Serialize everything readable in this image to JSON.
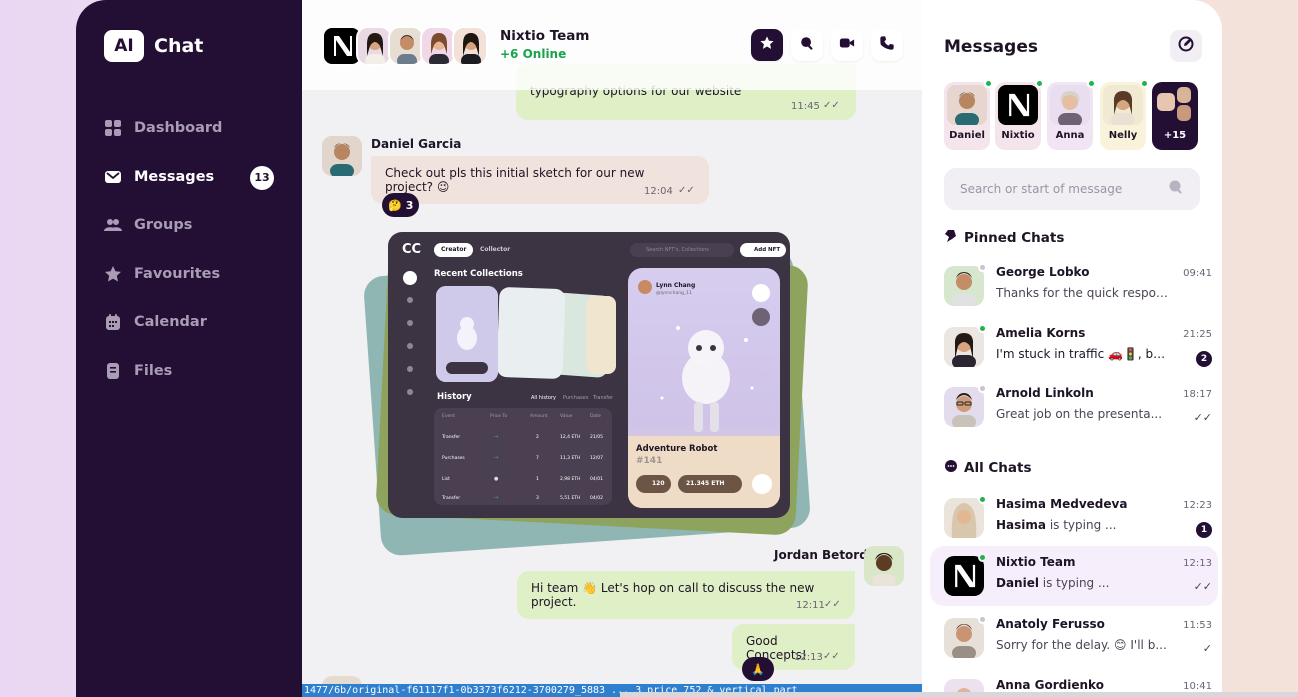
{
  "sidebar": {
    "brand_badge": "AI",
    "brand_name": "Chat",
    "items": [
      {
        "label": "Dashboard",
        "icon": "grid-icon"
      },
      {
        "label": "Messages",
        "icon": "mail-icon",
        "badge": "13"
      },
      {
        "label": "Groups",
        "icon": "users-icon"
      },
      {
        "label": "Favourites",
        "icon": "star-icon"
      },
      {
        "label": "Calendar",
        "icon": "calendar-icon"
      },
      {
        "label": "Files",
        "icon": "file-icon"
      }
    ]
  },
  "chat": {
    "header": {
      "team_name": "Nixtio Team",
      "online": "+6 Online"
    },
    "messages": {
      "m1_text": "typography options for our website",
      "m1_time": "11:45",
      "m2_sender": "Daniel Garcia",
      "m2_text": "Check out pls this initial sketch for our new project? 😉",
      "m2_time": "12:04",
      "m2_reaction": "🤔",
      "m2_reaction_count": "3",
      "m3_sender": "Jordan Betord",
      "m3_text": "Hi team 👋 Let's hop on call to discuss the new project.",
      "m3_time": "12:11",
      "m4_text": "Good Concepts!",
      "m4_time": "12:13",
      "m4_reaction": "🙏"
    },
    "card": {
      "logo": "CC",
      "tab_creator": "Creator",
      "tab_collector": "Collector",
      "search": "Search NFT's, Collections",
      "add_nft": "Add NFT",
      "recent_title": "Recent Collections",
      "history_title": "History",
      "history_tabs": [
        "All history",
        "Purchases",
        "Transfer"
      ],
      "history_headers": [
        "Event",
        "Price To",
        "Amount",
        "Value",
        "Date"
      ],
      "history_rows": [
        [
          "Transfer",
          "→",
          "2",
          "12,4 ETH",
          "21/05"
        ],
        [
          "Purchases",
          "→",
          "7",
          "11,3 ETH",
          "12/07"
        ],
        [
          "List",
          "●",
          "1",
          "2,98 ETH",
          "04/01"
        ],
        [
          "Transfer",
          "→",
          "3",
          "5,51 ETH",
          "04/02"
        ]
      ],
      "creator_name": "Lynn Chang",
      "creator_handle": "@lynnchang_11",
      "nft_title": "Adventure Robot",
      "nft_id": "#141",
      "likes": "120",
      "price": "21.345 ETH"
    },
    "statusbar_text": "1477/6b/original-f61117f1-0b3373f6212-3700279_5883 ... 3 price 752 & vertical part"
  },
  "panel": {
    "title": "Messages",
    "stories": [
      {
        "name": "Daniel",
        "color": "#f4e4ec"
      },
      {
        "name": "Nixtio",
        "color": "#f4e4ec"
      },
      {
        "name": "Anna",
        "color": "#f1e5f3"
      },
      {
        "name": "Nelly",
        "color": "#faf3dc"
      },
      {
        "name": "+15",
        "color": "#230f33"
      }
    ],
    "search_placeholder": "Search or start of message",
    "pinned_title": "Pinned Chats",
    "all_title": "All Chats",
    "pinned": [
      {
        "name": "George Lobko",
        "msg": "Thanks for the quick respons...",
        "time": "09:41",
        "status": "#c9c4cd"
      },
      {
        "name": "Amelia Korns",
        "msg": "I'm stuck in traffic 🚗🚦, bu...",
        "time": "21:25",
        "badge": "2",
        "status": "#22b24c"
      },
      {
        "name": "Arnold Linkoln",
        "msg": "Great job on the presenta...",
        "time": "18:17",
        "check": "✓✓",
        "status": "#c9c4cd"
      }
    ],
    "all": [
      {
        "name": "Hasima Medvedeva",
        "who": "Hasima",
        "msg": " is typing ...",
        "time": "12:23",
        "badge": "1",
        "status": "#22b24c"
      },
      {
        "name": "Nixtio Team",
        "who": "Daniel",
        "msg": " is typing ...",
        "time": "12:13",
        "check": "✓✓",
        "status": "#22b24c"
      },
      {
        "name": "Anatoly Ferusso",
        "msg": "Sorry for the delay. 😊 I'll b...",
        "time": "11:53",
        "check": "✓",
        "status": "#c9c4cd"
      },
      {
        "name": "Anna Gordienko",
        "msg": "",
        "time": "10:41",
        "status": "#c9c4cd"
      }
    ]
  }
}
